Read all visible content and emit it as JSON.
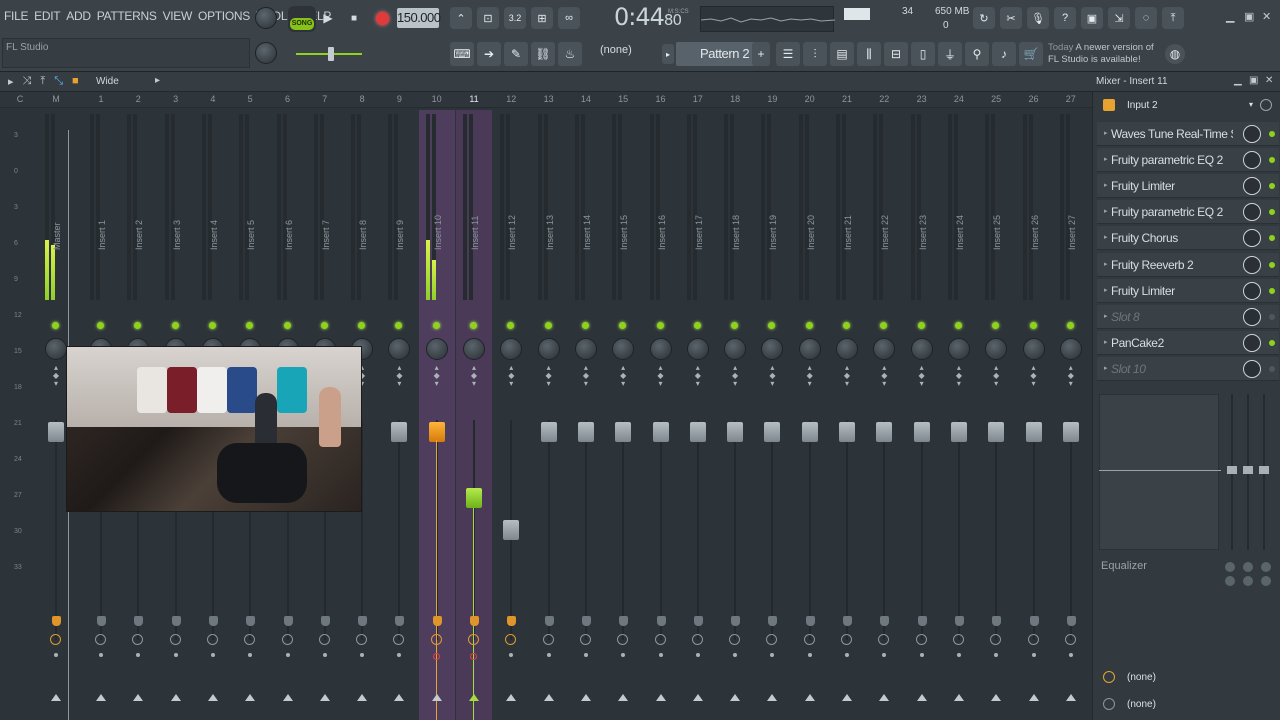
{
  "menu": [
    "FILE",
    "EDIT",
    "ADD",
    "PATTERNS",
    "VIEW",
    "OPTIONS",
    "TOOLS",
    "HELP"
  ],
  "hint": "FL Studio",
  "transport": {
    "mode": "SONG",
    "tempo": "150.000",
    "time_main": "0:44",
    "time_sub": "80",
    "time_unit": "M:S:CS"
  },
  "cpu": {
    "value": "34",
    "memory": "650 MB",
    "polyphony": "0"
  },
  "toolbar": {
    "channel_select": "(none)",
    "pattern": "Pattern 2"
  },
  "news": {
    "label": "Today",
    "text": "A newer version of FL Studio is available!"
  },
  "mixer_header": {
    "snap": "Wide",
    "title": "Mixer - Insert 11"
  },
  "ruler": [
    "C",
    "M",
    "1",
    "2",
    "3",
    "4",
    "5",
    "6",
    "7",
    "8",
    "9",
    "10",
    "11",
    "12",
    "13",
    "14",
    "15",
    "16",
    "17",
    "18",
    "19",
    "20",
    "21",
    "22",
    "23",
    "24",
    "25",
    "26",
    "27"
  ],
  "db_scale": [
    "3",
    "0",
    "3",
    "6",
    "9",
    "12",
    "15",
    "18",
    "21",
    "24",
    "27",
    "30",
    "33"
  ],
  "strips": [
    {
      "label": "Master"
    },
    {
      "label": "Insert 1"
    },
    {
      "label": "Insert 2"
    },
    {
      "label": "Insert 3"
    },
    {
      "label": "Insert 4"
    },
    {
      "label": "Insert 5"
    },
    {
      "label": "Insert 6"
    },
    {
      "label": "Insert 7"
    },
    {
      "label": "Insert 8"
    },
    {
      "label": "Insert 9"
    },
    {
      "label": "Insert 10"
    },
    {
      "label": "Insert 11"
    },
    {
      "label": "Insert 12"
    },
    {
      "label": "Insert 13"
    },
    {
      "label": "Insert 14"
    },
    {
      "label": "Insert 15"
    },
    {
      "label": "Insert 16"
    },
    {
      "label": "Insert 17"
    },
    {
      "label": "Insert 18"
    },
    {
      "label": "Insert 19"
    },
    {
      "label": "Insert 20"
    },
    {
      "label": "Insert 21"
    },
    {
      "label": "Insert 22"
    },
    {
      "label": "Insert 23"
    },
    {
      "label": "Insert 24"
    },
    {
      "label": "Insert 25"
    },
    {
      "label": "Insert 26"
    },
    {
      "label": "Insert 27"
    }
  ],
  "panel": {
    "input": "Input 2",
    "slots": [
      {
        "name": "Waves Tune Real-Time S...",
        "empty": false
      },
      {
        "name": "Fruity parametric EQ 2",
        "empty": false
      },
      {
        "name": "Fruity Limiter",
        "empty": false
      },
      {
        "name": "Fruity parametric EQ 2",
        "empty": false
      },
      {
        "name": "Fruity Chorus",
        "empty": false
      },
      {
        "name": "Fruity Reeverb 2",
        "empty": false
      },
      {
        "name": "Fruity Limiter",
        "empty": false
      },
      {
        "name": "Slot 8",
        "empty": true
      },
      {
        "name": "PanCake2",
        "empty": false
      },
      {
        "name": "Slot 10",
        "empty": true
      }
    ],
    "eq_label": "Equalizer",
    "output_1": "(none)",
    "output_2": "(none)"
  },
  "colors": {
    "accent_green": "#8fd21d",
    "selected_strip": "#4f3d5e",
    "orange": "#e8a236"
  }
}
